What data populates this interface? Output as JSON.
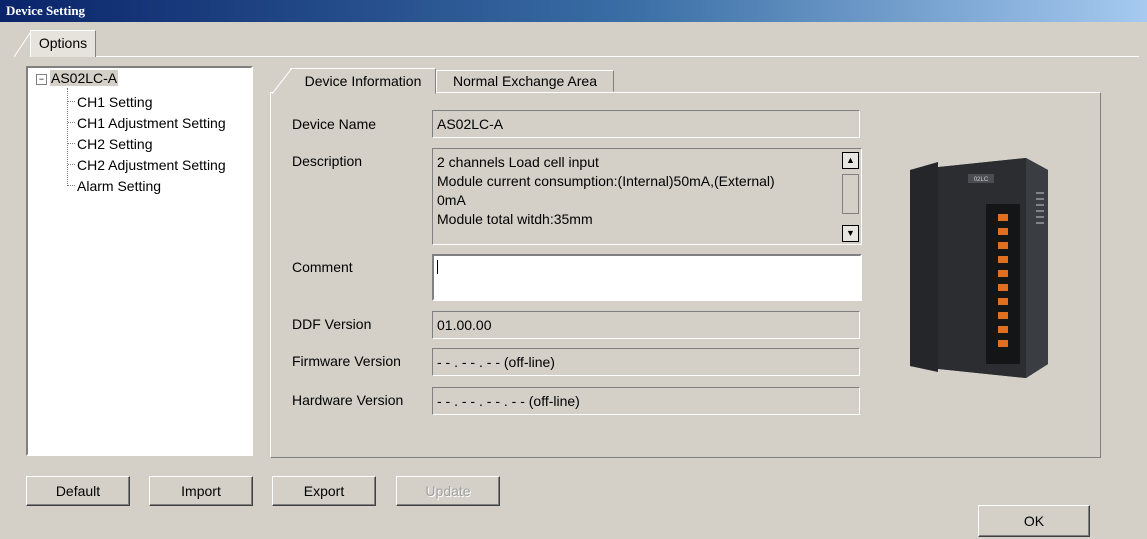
{
  "window": {
    "title": "Device Setting"
  },
  "options_tab": {
    "label": "Options"
  },
  "tree": {
    "root": "AS02LC-A",
    "items": [
      "CH1 Setting",
      "CH1 Adjustment Setting",
      "CH2 Setting",
      "CH2 Adjustment Setting",
      "Alarm Setting"
    ]
  },
  "tabs": {
    "device_information": "Device Information",
    "normal_exchange_area": "Normal Exchange Area"
  },
  "fields": {
    "device_name": {
      "label": "Device Name",
      "value": "AS02LC-A"
    },
    "description": {
      "label": "Description",
      "lines": [
        "2 channels Load cell input",
        "Module current consumption:(Internal)50mA,(External)",
        "0mA",
        "Module total witdh:35mm"
      ]
    },
    "comment": {
      "label": "Comment",
      "value": ""
    },
    "ddf_version": {
      "label": "DDF Version",
      "value": "01.00.00"
    },
    "firmware_version": {
      "label": "Firmware Version",
      "value": "- - . - - . - - (off-line)"
    },
    "hardware_version": {
      "label": "Hardware Version",
      "value": "- - . - - . - - . - - (off-line)"
    }
  },
  "device_image": {
    "badge": "02LC"
  },
  "buttons": {
    "default": "Default",
    "import": "Import",
    "export": "Export",
    "update": "Update",
    "ok": "OK"
  },
  "colors": {
    "face": "#d4d0c8",
    "title_start": "#0a246a",
    "title_end": "#a6caf0",
    "device_body": "#2b2d30",
    "terminal": "#e07020"
  }
}
